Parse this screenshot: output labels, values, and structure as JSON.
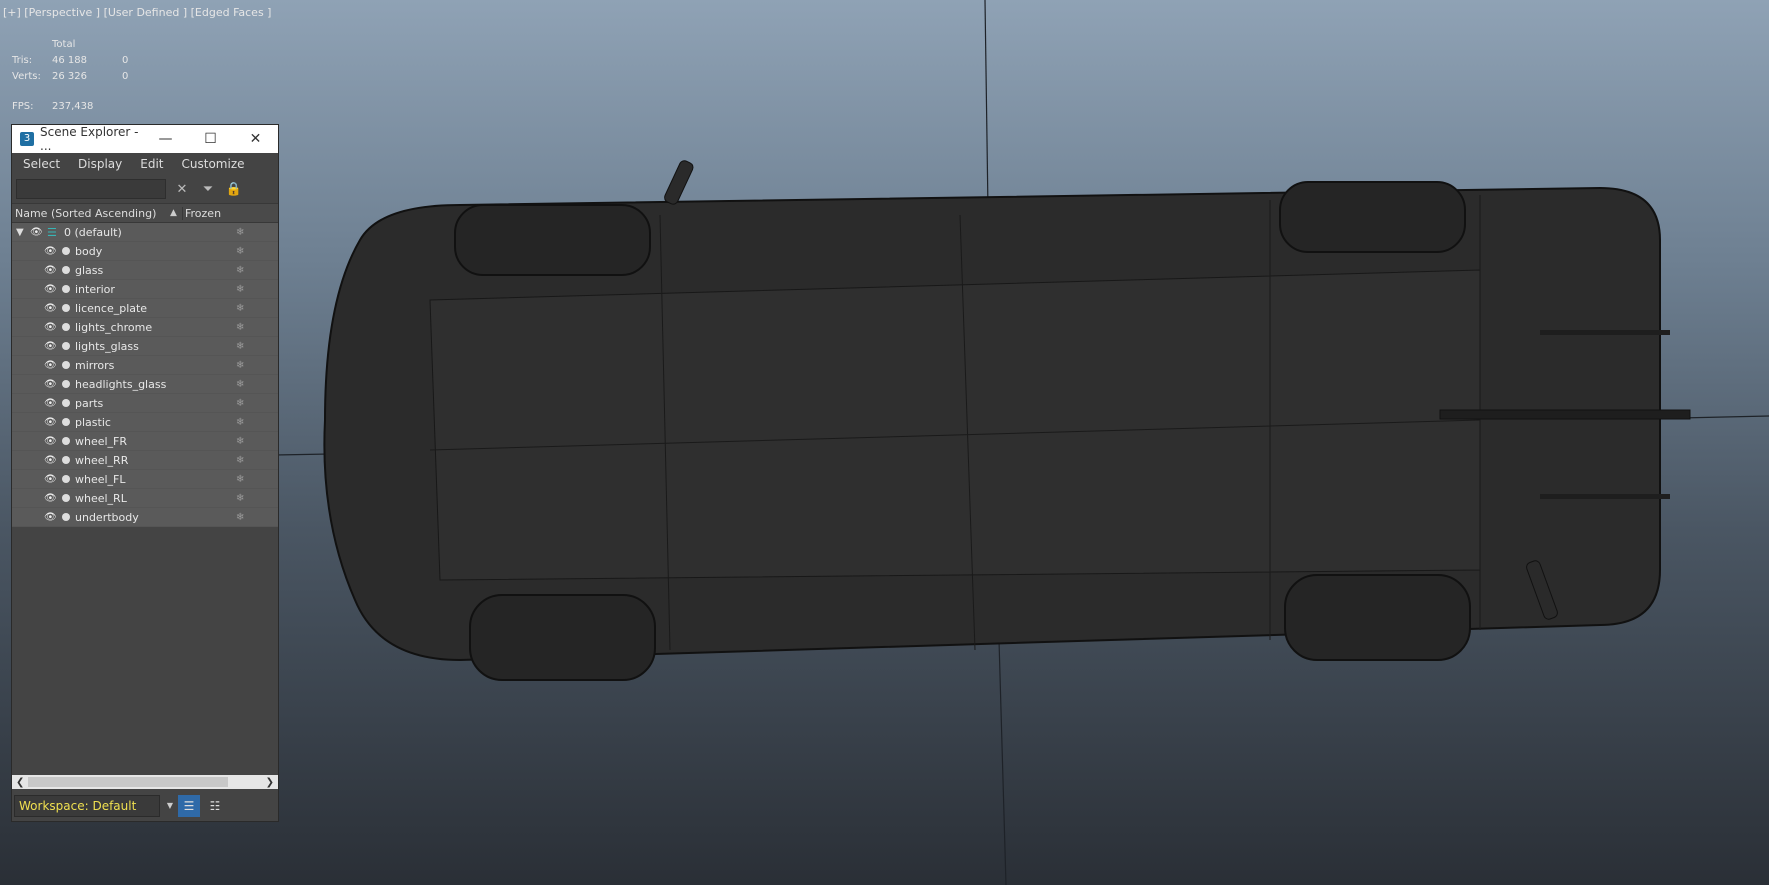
{
  "viewport": {
    "label": "[+] [Perspective ] [User Defined ] [Edged Faces ]",
    "stats": {
      "total_label": "Total",
      "tris_label": "Tris:",
      "tris_total": "46 188",
      "tris_sel": "0",
      "verts_label": "Verts:",
      "verts_total": "26 326",
      "verts_sel": "0",
      "fps_label": "FPS:",
      "fps_value": "237,438"
    }
  },
  "explorer": {
    "title": "Scene Explorer - ...",
    "app_icon": "3",
    "window_buttons": [
      "minimize-icon",
      "maximize-icon",
      "close-icon"
    ],
    "menus": [
      "Select",
      "Display",
      "Edit",
      "Customize"
    ],
    "search": {
      "value": "",
      "placeholder": ""
    },
    "columns": {
      "name": "Name (Sorted Ascending)",
      "frozen": "Frozen"
    },
    "layer": {
      "name": "0 (default)"
    },
    "objects": [
      "body",
      "glass",
      "interior",
      "licence_plate",
      "lights_chrome",
      "lights_glass",
      "mirrors",
      "headlights_glass",
      "parts",
      "plastic",
      "wheel_FR",
      "wheel_RR",
      "wheel_FL",
      "wheel_RL",
      "undertbody"
    ],
    "workspace": "Workspace: Default"
  },
  "colors": {
    "workspace_text": "#f0e050",
    "layer_icon": "#37b5b5",
    "active_button": "#2f6aa8"
  }
}
